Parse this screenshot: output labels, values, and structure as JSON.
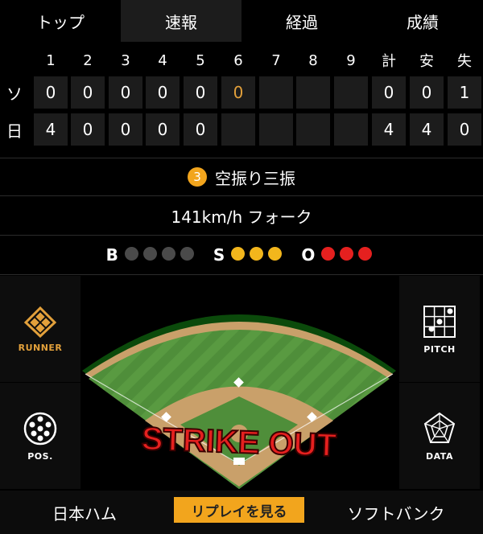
{
  "tabs": [
    "トップ",
    "速報",
    "経過",
    "成績"
  ],
  "scoreboard": {
    "headers": [
      "1",
      "2",
      "3",
      "4",
      "5",
      "6",
      "7",
      "8",
      "9",
      "計",
      "安",
      "失"
    ],
    "rows": [
      {
        "team": "ソ",
        "cells": [
          "0",
          "0",
          "0",
          "0",
          "0",
          "0",
          "",
          "",
          "",
          "0",
          "0",
          "1"
        ]
      },
      {
        "team": "日",
        "cells": [
          "4",
          "0",
          "0",
          "0",
          "0",
          "",
          "",
          "",
          "",
          "4",
          "4",
          "0"
        ]
      }
    ]
  },
  "play": {
    "badge": "3",
    "text": "空振り三振"
  },
  "pitch": {
    "text": "141km/h フォーク"
  },
  "count": {
    "b_label": "B",
    "s_label": "S",
    "o_label": "O",
    "balls": 0,
    "strikes": 3,
    "outs": 3,
    "colors": {
      "ball_off": "#4a4a4a",
      "strike_on": "#f2b61c",
      "out_on": "#e5201f"
    }
  },
  "side_buttons": {
    "runner": "RUNNER",
    "pos": "POS.",
    "pitch": "PITCH",
    "data": "DATA"
  },
  "field": {
    "overlay": "STRIKE OUT"
  },
  "bottom": {
    "home": "日本ハム",
    "replay": "リプレイを見る",
    "away": "ソフトバンク"
  },
  "colors": {
    "accent": "#f2a51d",
    "highlight": "#e2a03b"
  }
}
